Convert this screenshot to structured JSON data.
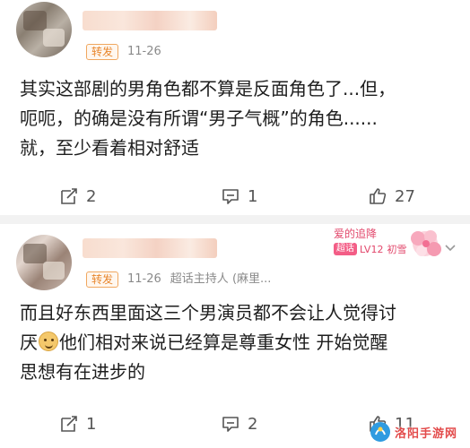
{
  "posts": [
    {
      "repost_tag": "转发",
      "date": "11-26",
      "content_lines": [
        "其实这部剧的男角色都不算是反面角色了...但，",
        "呃呃，的确是没有所谓“男子气概”的角色......",
        "就，至少看着相对舒适"
      ],
      "actions": {
        "repost_count": "2",
        "comment_count": "1",
        "like_count": "27"
      }
    },
    {
      "repost_tag": "转发",
      "date": "11-26",
      "role": "超话主持人",
      "source": "(麻里...",
      "fan_badge": {
        "title": "爱的追降",
        "super": "超话",
        "level": "LV12",
        "level_text": "初雪"
      },
      "content_lines": [
        "而且好东西里面这三个男演员都不会让人觉得讨",
        "他们相对来说已经算是尊重女性 开始觉醒",
        "思想有在进步的"
      ],
      "line2_prefix": "厌",
      "actions": {
        "repost_count": "1",
        "comment_count": "2",
        "like_count": "11"
      }
    }
  ],
  "watermark": {
    "text": "洛阳手游网"
  },
  "icons": {
    "repost": "repost-icon",
    "comment": "comment-icon",
    "like": "thumbs-up-icon",
    "more": "chevron-down-icon"
  },
  "colors": {
    "accent_orange": "#e8862c",
    "meta_gray": "#8a8a8a",
    "badge_pink": "#e2476b"
  }
}
